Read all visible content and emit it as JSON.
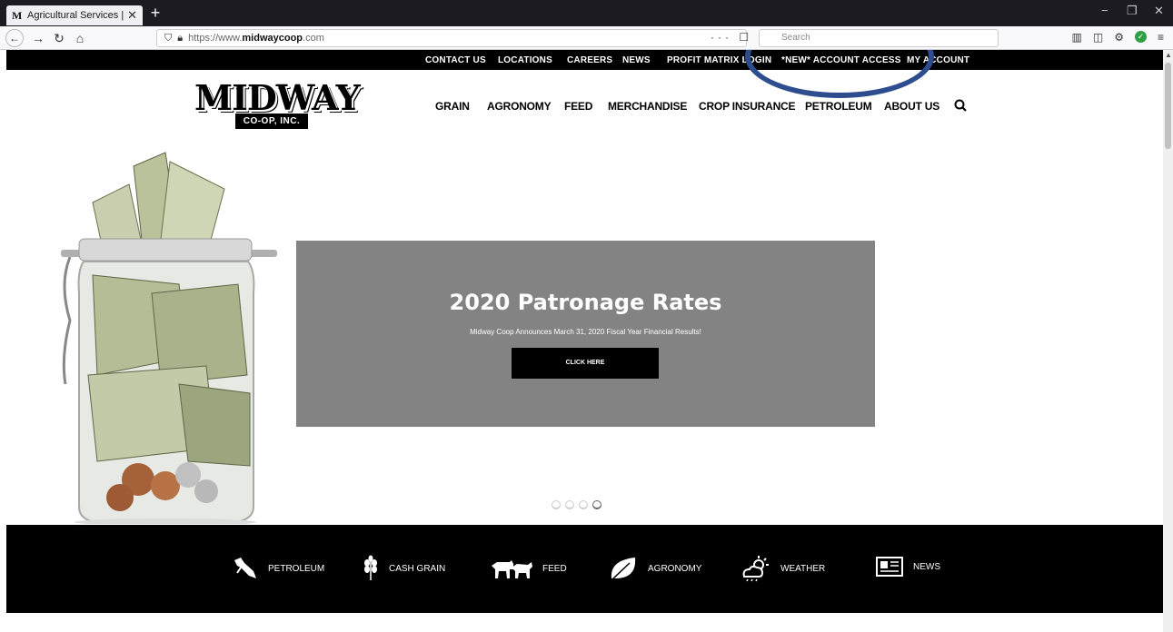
{
  "browser": {
    "tab_title": "Agricultural Services | Livestock",
    "tab_favicon": "M",
    "tab_close": "✕",
    "new_tab": "+",
    "url_prefix": "https://www.",
    "url_host": "midwaycoop",
    "url_suffix": ".com",
    "search_placeholder": "Search",
    "url_actions": "··· ☐ ☆",
    "window_controls": [
      "−",
      "❐",
      "✕"
    ]
  },
  "top_nav": [
    "CONTACT US",
    "LOCATIONS",
    "CAREERS",
    "NEWS",
    "PROFIT MATRIX LOGIN",
    "*NEW* ACCOUNT ACCESS",
    "MY ACCOUNT"
  ],
  "logo": {
    "word": "MIDWAY",
    "sub": "CO-OP, INC."
  },
  "main_nav": [
    "GRAIN",
    "AGRONOMY",
    "FEED",
    "MERCHANDISE",
    "CROP INSURANCE",
    "PETROLEUM",
    "ABOUT US"
  ],
  "slide": {
    "title": "2020 Patronage Rates",
    "subtitle": "Midway Coop Announces March 31, 2020 Fiscal Year Financial Results!",
    "cta": "CLICK HERE",
    "slide_count": 4,
    "active_slide": 4
  },
  "services": [
    {
      "label": "PETROLEUM",
      "icon": "fuel-nozzle-icon"
    },
    {
      "label": "CASH GRAIN",
      "icon": "wheat-icon"
    },
    {
      "label": "FEED",
      "icon": "livestock-icon"
    },
    {
      "label": "AGRONOMY",
      "icon": "leaf-icon"
    },
    {
      "label": "WEATHER",
      "icon": "weather-icon"
    },
    {
      "label": "NEWS",
      "icon": "newspaper-icon"
    }
  ],
  "colors": {
    "annotation": "#2e4d8e",
    "slide_bg": "#838383"
  }
}
